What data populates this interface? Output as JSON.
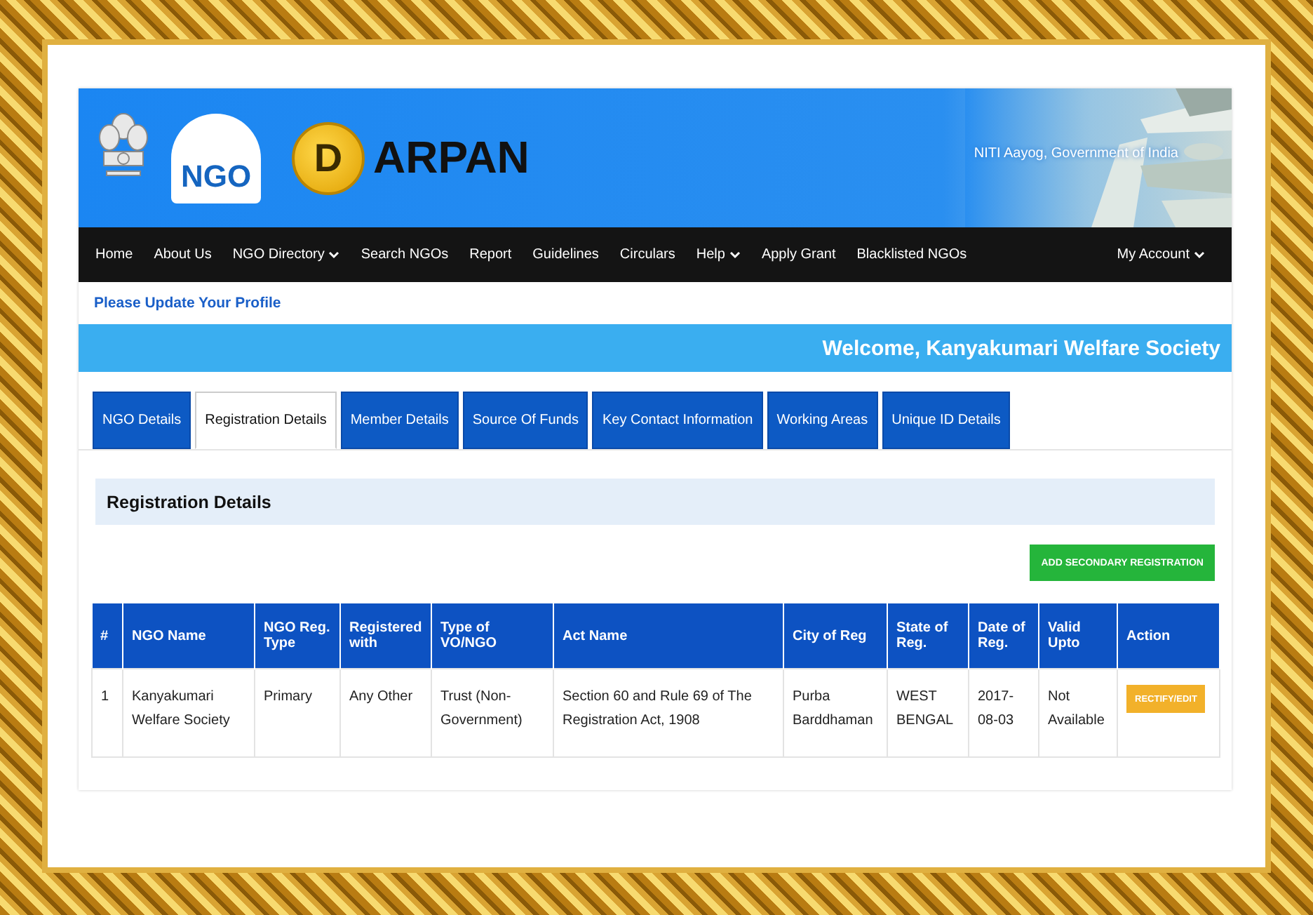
{
  "header": {
    "ngo_logo": "NGO",
    "coin_letter": "D",
    "title": "ARPAN",
    "tagline": "NITI Aayog, Government of India"
  },
  "nav": [
    {
      "label": "Home",
      "dropdown": false
    },
    {
      "label": "About Us",
      "dropdown": false
    },
    {
      "label": "NGO Directory",
      "dropdown": true
    },
    {
      "label": "Search NGOs",
      "dropdown": false
    },
    {
      "label": "Report",
      "dropdown": false
    },
    {
      "label": "Guidelines",
      "dropdown": false
    },
    {
      "label": "Circulars",
      "dropdown": false
    },
    {
      "label": "Help",
      "dropdown": true
    },
    {
      "label": "Apply Grant",
      "dropdown": false
    },
    {
      "label": "Blacklisted NGOs",
      "dropdown": false
    }
  ],
  "account_menu": {
    "label": "My Account",
    "dropdown": true
  },
  "profile_link": "Please Update Your Profile",
  "welcome": "Welcome, Kanyakumari Welfare Society",
  "tabs": [
    {
      "label": "NGO Details",
      "selected": false
    },
    {
      "label": "Registration Details",
      "selected": true
    },
    {
      "label": "Member Details",
      "selected": false
    },
    {
      "label": "Source Of Funds",
      "selected": false
    },
    {
      "label": "Key Contact Information",
      "selected": false
    },
    {
      "label": "Working Areas",
      "selected": false
    },
    {
      "label": "Unique ID Details",
      "selected": false
    }
  ],
  "panel": {
    "title": "Registration Details",
    "add_button": "ADD SECONDARY REGISTRATION"
  },
  "table": {
    "columns": [
      "#",
      "NGO Name",
      "NGO Reg. Type",
      "Registered with",
      "Type of VO/NGO",
      "Act Name",
      "City of Reg",
      "State of Reg.",
      "Date of Reg.",
      "Valid Upto",
      "Action"
    ],
    "rows": [
      {
        "cells": [
          "1",
          "Kanyakumari Welfare Society",
          "Primary",
          "Any Other",
          "Trust (Non-Government)",
          "Section 60 and Rule 69 of The Registration Act, 1908",
          "Purba Barddhaman",
          "WEST BENGAL",
          "2017-08-03",
          "Not Available"
        ],
        "action": "RECTIFY/EDIT"
      }
    ]
  }
}
